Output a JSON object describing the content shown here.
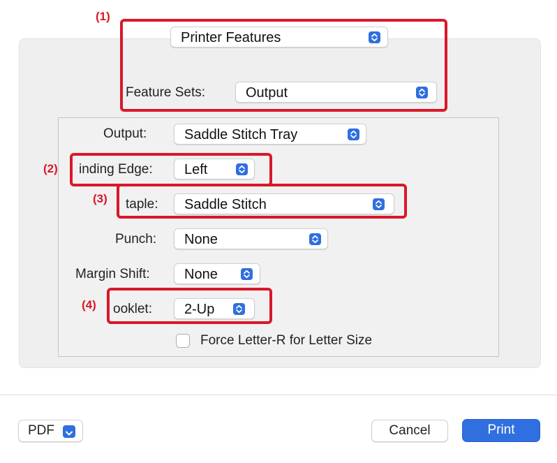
{
  "annotations": {
    "n1": "(1)",
    "n2": "(2)",
    "n3": "(3)",
    "n4": "(4)"
  },
  "header": {
    "panel_popup_value": "Printer Features",
    "feature_sets_label": "Feature Sets:",
    "feature_sets_value": "Output"
  },
  "options": {
    "output_label": "Output:",
    "output_value": "Saddle Stitch Tray",
    "binding_edge_label": "inding Edge:",
    "binding_edge_value": "Left",
    "staple_label": "taple:",
    "staple_value": "Saddle Stitch",
    "punch_label": "Punch:",
    "punch_value": "None",
    "margin_shift_label": "Margin Shift:",
    "margin_shift_value": "None",
    "booklet_label": "ooklet:",
    "booklet_value": "2-Up",
    "force_letter_label": "Force Letter-R for Letter Size",
    "force_letter_checked": false
  },
  "footer": {
    "pdf_label": "PDF",
    "cancel_label": "Cancel",
    "print_label": "Print"
  },
  "colors": {
    "accent": "#2f6fe0",
    "highlight": "#d9182a"
  },
  "icons": {
    "popup": "up-down-chevron-icon",
    "pdf_menu": "chevron-down-icon"
  }
}
